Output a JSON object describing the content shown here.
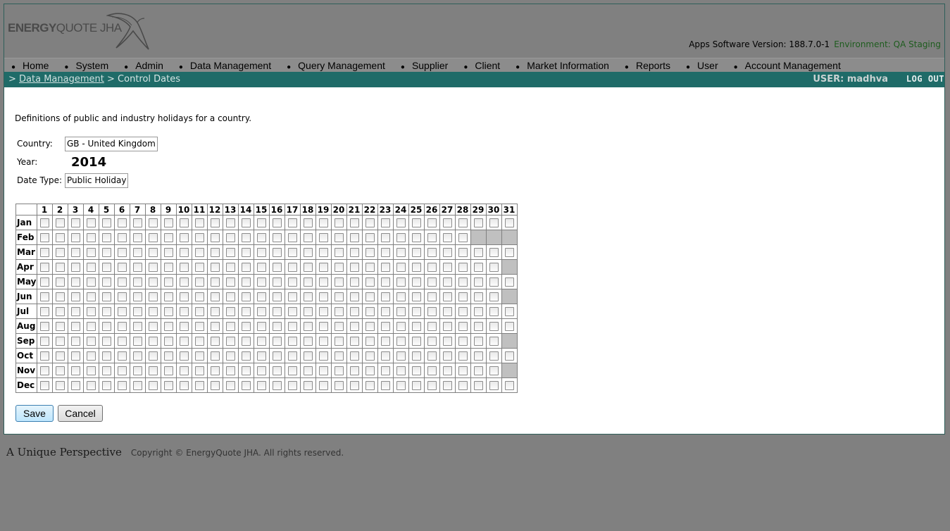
{
  "logo": {
    "brand_bold": "ENERGY",
    "brand_rest": "QUOTE JHA",
    "icon": "swallow-bird-logo"
  },
  "version": {
    "label": "Apps Software Version: 188.7.0-1",
    "env": "Environment: QA Staging"
  },
  "menu": [
    "Home",
    "System",
    "Admin",
    "Data Management",
    "Query Management",
    "Supplier",
    "Client",
    "Market Information",
    "Reports",
    "User",
    "Account Management"
  ],
  "breadcrumb": {
    "prefix": ">",
    "link": "Data Management",
    "sep": ">",
    "current": "Control Dates"
  },
  "user": {
    "label": "USER: madhva",
    "logout": "LOG OUT"
  },
  "description": "Definitions of public and industry holidays for a country.",
  "form": {
    "country_label": "Country:",
    "country_value": "GB - United Kingdom",
    "year_label": "Year:",
    "year_value": "2014",
    "datetype_label": "Date Type:",
    "datetype_value": "Public Holiday"
  },
  "grid": {
    "days": [
      "1",
      "2",
      "3",
      "4",
      "5",
      "6",
      "7",
      "8",
      "9",
      "10",
      "11",
      "12",
      "13",
      "14",
      "15",
      "16",
      "17",
      "18",
      "19",
      "20",
      "21",
      "22",
      "23",
      "24",
      "25",
      "26",
      "27",
      "28",
      "29",
      "30",
      "31"
    ],
    "months": [
      {
        "name": "Jan",
        "days": 31
      },
      {
        "name": "Feb",
        "days": 28
      },
      {
        "name": "Mar",
        "days": 31
      },
      {
        "name": "Apr",
        "days": 30
      },
      {
        "name": "May",
        "days": 31
      },
      {
        "name": "Jun",
        "days": 30
      },
      {
        "name": "Jul",
        "days": 31
      },
      {
        "name": "Aug",
        "days": 31
      },
      {
        "name": "Sep",
        "days": 30
      },
      {
        "name": "Oct",
        "days": 31
      },
      {
        "name": "Nov",
        "days": 30
      },
      {
        "name": "Dec",
        "days": 31
      }
    ]
  },
  "buttons": {
    "save": "Save",
    "cancel": "Cancel"
  },
  "footer": {
    "tagline": "A Unique Perspective",
    "copyright": "Copyright © EnergyQuote JHA. All rights reserved."
  }
}
